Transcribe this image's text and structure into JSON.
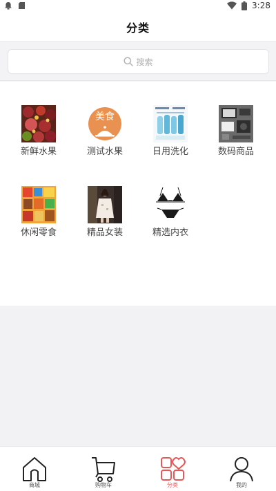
{
  "status_bar": {
    "time": "3:28",
    "icons": [
      "notification-icon",
      "sd-card-icon",
      "wifi-icon",
      "battery-icon"
    ]
  },
  "header": {
    "title": "分类"
  },
  "search": {
    "placeholder": "搜索"
  },
  "categories": [
    {
      "label": "新鲜水果",
      "icon": "fruit-photo"
    },
    {
      "label": "测试水果",
      "icon": "food-badge",
      "badge_text": "美食",
      "badge_color": "#e99150"
    },
    {
      "label": "日用洗化",
      "icon": "toiletries-photo"
    },
    {
      "label": "数码商品",
      "icon": "electronics-photo"
    },
    {
      "label": "休闲零食",
      "icon": "snacks-photo"
    },
    {
      "label": "精品女装",
      "icon": "womens-clothing-photo"
    },
    {
      "label": "精选内衣",
      "icon": "lingerie-photo"
    }
  ],
  "tabbar": {
    "items": [
      {
        "label": "商城",
        "icon": "home-icon",
        "active": false
      },
      {
        "label": "购物车",
        "icon": "cart-icon",
        "active": false
      },
      {
        "label": "分类",
        "icon": "category-icon",
        "active": true
      },
      {
        "label": "我的",
        "icon": "user-icon",
        "active": false
      }
    ]
  },
  "colors": {
    "accent": "#e45858",
    "background": "#f2f2f4"
  }
}
